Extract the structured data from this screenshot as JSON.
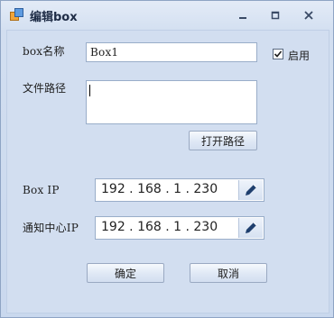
{
  "window": {
    "title": "编辑box"
  },
  "form": {
    "box_name_label": "box名称",
    "box_name_value": "Box1",
    "enable_label": "启用",
    "enable_checked": true,
    "file_path_label": "文件路径",
    "file_path_value": "",
    "open_path_button": "打开路径",
    "box_ip_label": "Box IP",
    "box_ip_value": "192 . 168 . 1 . 230",
    "notify_ip_label": "通知中心IP",
    "notify_ip_value": "192 . 168 . 1 . 230",
    "ok_button": "确定",
    "cancel_button": "取消"
  },
  "icons": {
    "app": "app-window-icon",
    "minimize": "minimize-icon",
    "maximize": "maximize-icon",
    "close": "close-icon",
    "edit": "pencil-icon"
  }
}
